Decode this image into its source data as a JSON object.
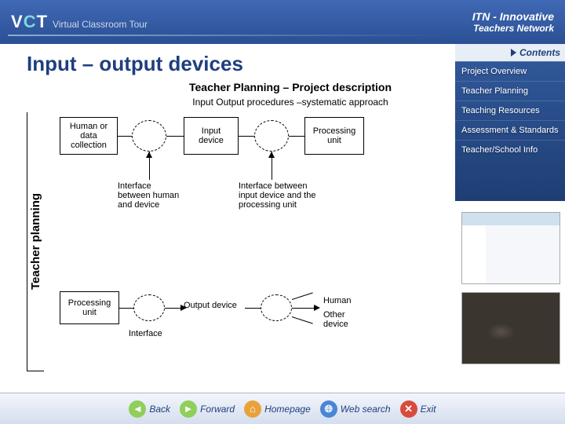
{
  "header": {
    "logo_v": "V",
    "logo_c": "C",
    "logo_t": "T",
    "logo_sub": "Virtual Classroom Tour",
    "itn_line1": "ITN - Innovative",
    "itn_line2": "Teachers Network"
  },
  "sidebar": {
    "contents_label": "Contents",
    "items": [
      "Project Overview",
      "Teacher Planning",
      "Teaching Resources",
      "Assessment & Standards",
      "Teacher/School Info"
    ]
  },
  "page": {
    "title": "Input – output devices",
    "section_title": "Teacher Planning – Project description",
    "section_sub": "Input Output procedures –systematic approach",
    "vertical_label": "Teacher planning"
  },
  "diagram": {
    "box_human_data": "Human or data collection",
    "box_input_device": "Input device",
    "box_processing_unit": "Processing unit",
    "label_interface_human": "Interface between human and device",
    "label_interface_proc": "Interface between input device and the processing unit",
    "box_processing_unit2": "Processing unit",
    "label_interface2": "Interface",
    "box_output_device": "Output device",
    "label_human": "Human",
    "label_other_device": "Other device"
  },
  "footer": {
    "back": "Back",
    "forward": "Forward",
    "homepage": "Homepage",
    "websearch": "Web search",
    "exit": "Exit"
  }
}
